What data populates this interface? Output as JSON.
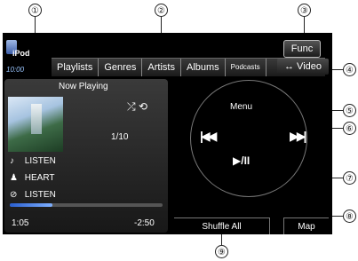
{
  "callouts": [
    "①",
    "②",
    "③",
    "④",
    "⑤",
    "⑥",
    "⑦",
    "⑧",
    "⑨"
  ],
  "header": {
    "source_label": "iPod",
    "clock": "10:00",
    "func_label": "Func",
    "video_label": "↔ Video"
  },
  "tabs": [
    "Playlists",
    "Genres",
    "Artists",
    "Albums",
    "Podcasts"
  ],
  "now_playing": {
    "title": "Now Playing",
    "mode_icons": "⤮ ⟲",
    "track_count": "1/10",
    "song": "LISTEN",
    "artist": "HEART",
    "album": "LISTEN",
    "progress_fraction": 0.28,
    "elapsed": "1:05",
    "remaining": "-2:50"
  },
  "icons": {
    "song": "note-icon",
    "artist": "person-icon",
    "album": "disc-icon"
  },
  "controls": {
    "menu_label": "Menu",
    "prev_label": "|◀◀",
    "next_label": "▶▶|",
    "play_label": "▶/II",
    "shuffle_label": "Shuffle All",
    "map_label": "Map"
  }
}
